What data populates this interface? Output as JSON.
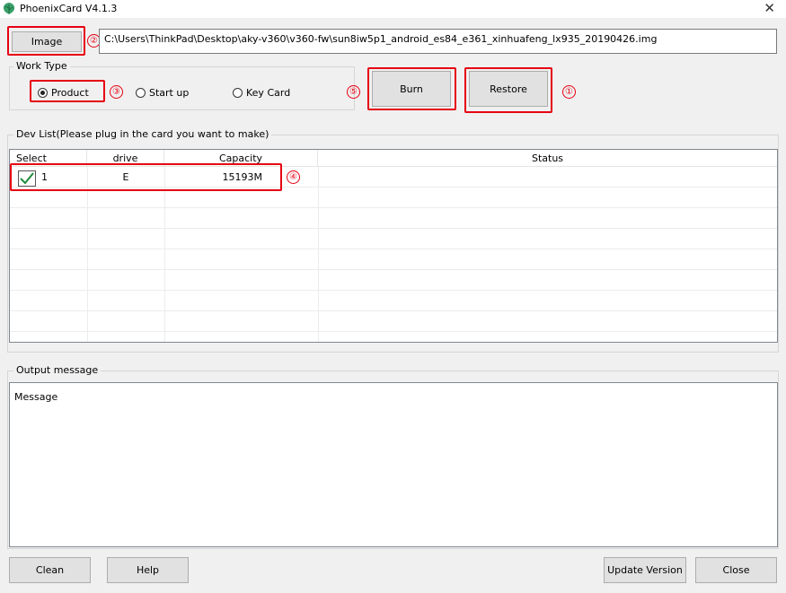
{
  "window": {
    "title": "PhoenixCard V4.1.3",
    "icon": "phoenix-leaf-icon",
    "close_glyph": "✕"
  },
  "image": {
    "button_label": "Image",
    "path": "C:\\Users\\ThinkPad\\Desktop\\aky-v360\\v360-fw\\sun8iw5p1_android_es84_e361_xinhuafeng_lx935_20190426.img"
  },
  "work_type": {
    "title": "Work Type",
    "options": [
      {
        "label": "Product",
        "selected": true
      },
      {
        "label": "Start up",
        "selected": false
      },
      {
        "label": "Key Card",
        "selected": false
      }
    ]
  },
  "actions": {
    "burn_label": "Burn",
    "restore_label": "Restore"
  },
  "dev_list": {
    "title": "Dev List(Please plug in the card you want to make)",
    "columns": [
      "Select",
      "drive",
      "Capacity",
      "Status"
    ],
    "rows": [
      {
        "select": "1",
        "checked": true,
        "drive": "E",
        "capacity": "15193M",
        "status": ""
      }
    ]
  },
  "output": {
    "title": "Output message",
    "message": "Message"
  },
  "footer": {
    "clean_label": "Clean",
    "help_label": "Help",
    "update_label": "Update Version",
    "close_label": "Close"
  },
  "annotations": [
    "①",
    "②",
    "③",
    "④",
    "⑤"
  ],
  "colors": {
    "annotation_red": "#e60012",
    "check_green": "#1f8a3a"
  }
}
